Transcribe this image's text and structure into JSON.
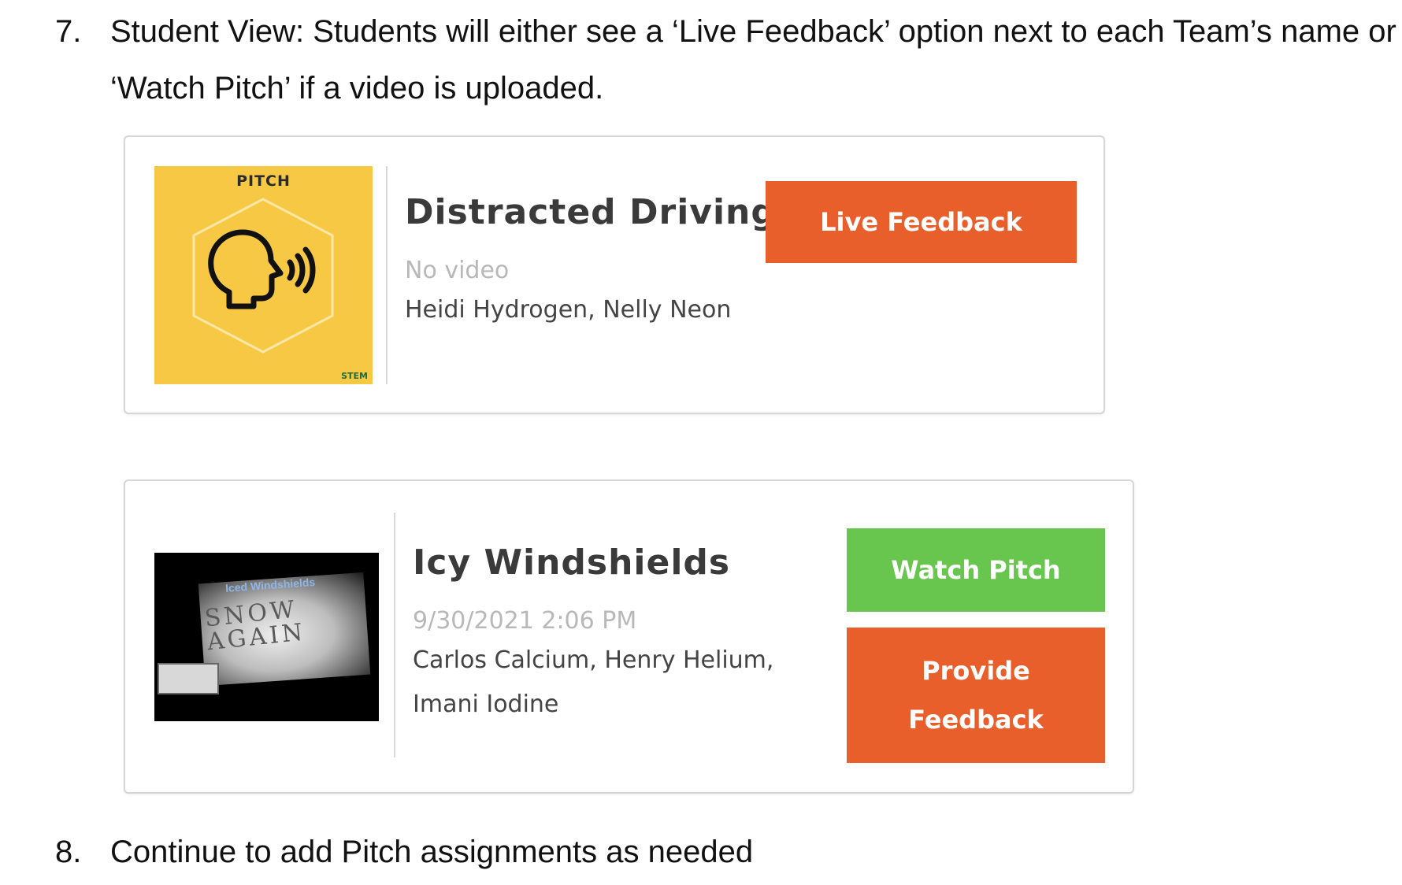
{
  "steps": [
    {
      "number": "7.",
      "text": "Student View: Students will either see a ‘Live Feedback’ option next to each Team’s name or ‘Watch Pitch’ if a video is uploaded."
    },
    {
      "number": "8.",
      "text": "Continue to add Pitch assignments as needed"
    }
  ],
  "cards": [
    {
      "thumbnail_label": "PITCH",
      "thumbnail_logo": "STEM",
      "thumbnail_icon": "speaking-head-icon",
      "title": "Distracted Driving",
      "meta": "No video",
      "members": "Heidi Hydrogen, Nelly Neon",
      "button_label": "Live Feedback",
      "button_color": "#e95f2c"
    },
    {
      "thumbnail_title": "Iced Windshields",
      "thumbnail_words": "SNOW AGAIN",
      "title": "Icy Windshields",
      "meta": "9/30/2021 2:06 PM",
      "members": "Carlos Calcium, Henry Helium, Imani Iodine",
      "primary_button_label": "Watch Pitch",
      "primary_button_color": "#68c64f",
      "secondary_button_label": "Provide Feedback",
      "secondary_button_color": "#e95f2c"
    }
  ],
  "colors": {
    "pitch_yellow": "#f7c844",
    "orange": "#e95f2c",
    "green": "#68c64f"
  }
}
